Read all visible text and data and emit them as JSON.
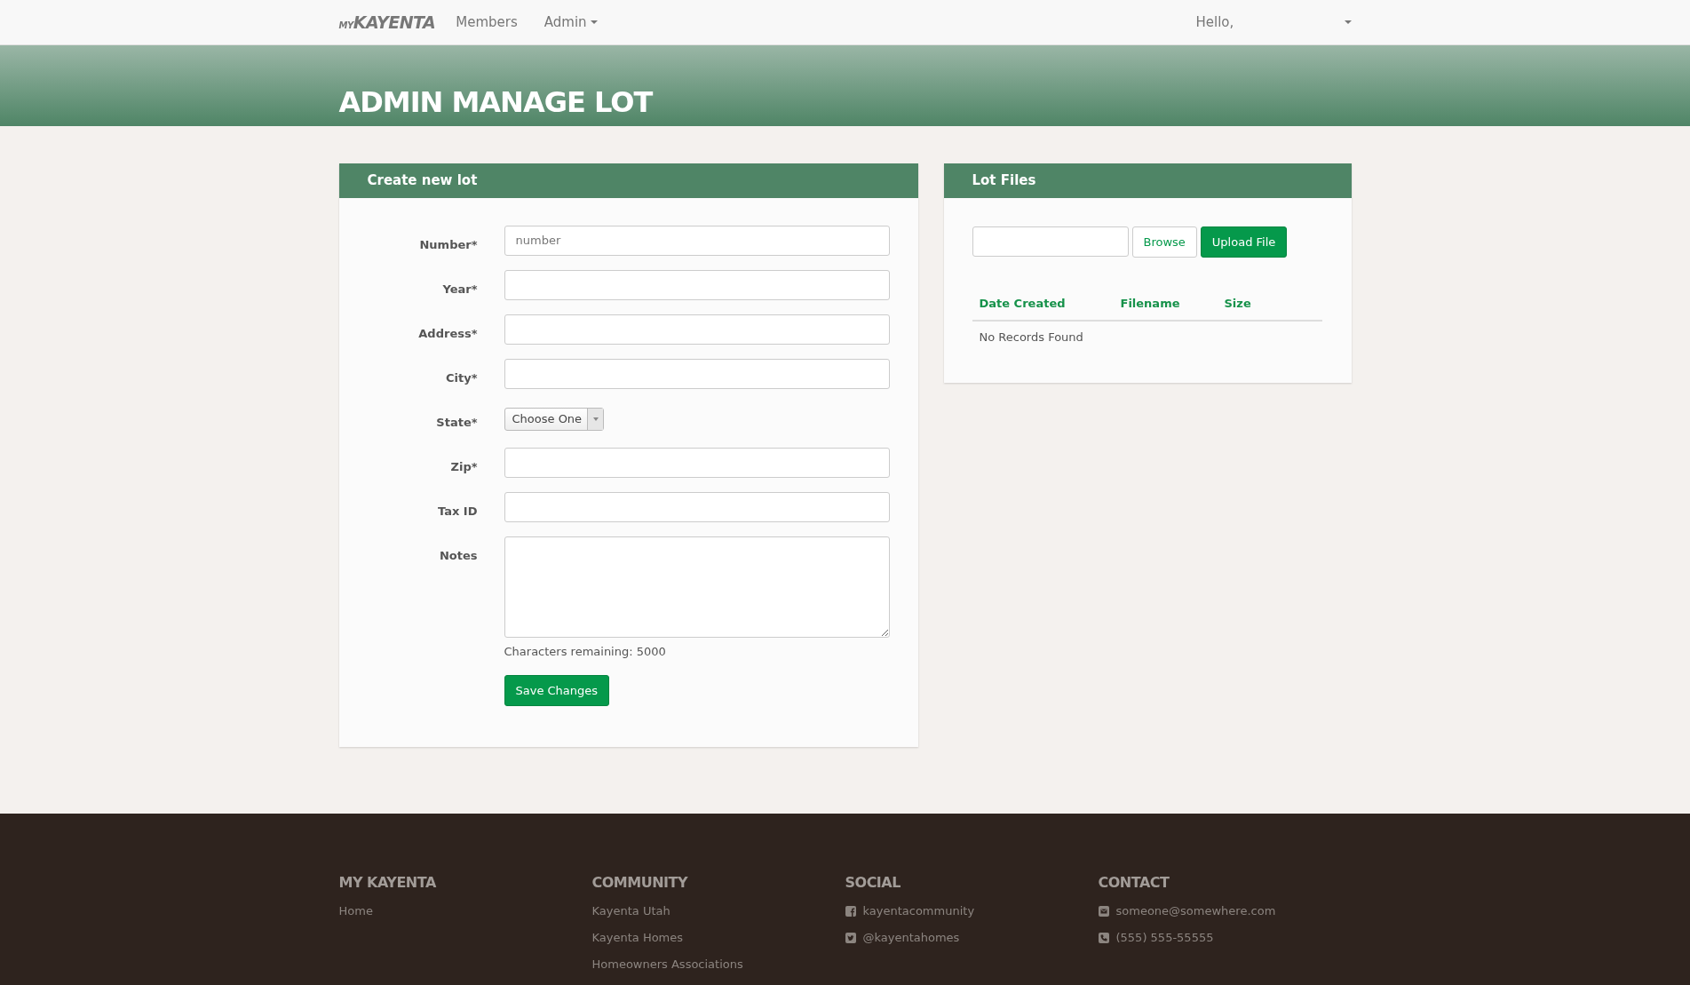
{
  "navbar": {
    "logo": {
      "small": "MY",
      "main": "KAYENTA"
    },
    "links": [
      {
        "label": "Members",
        "dropdown": false
      },
      {
        "label": "Admin",
        "dropdown": true
      }
    ],
    "user_menu": {
      "label": "Hello,"
    }
  },
  "page_title": "ADMIN MANAGE LOT",
  "create_form": {
    "title": "Create new lot",
    "fields": [
      {
        "kind": "text",
        "label": "Number*",
        "placeholder": "number"
      },
      {
        "kind": "text",
        "label": "Year*"
      },
      {
        "kind": "text",
        "label": "Address*"
      },
      {
        "kind": "text",
        "label": "City*"
      },
      {
        "kind": "select",
        "label": "State*",
        "value": "Choose One"
      },
      {
        "kind": "text",
        "label": "Zip*"
      },
      {
        "kind": "text",
        "label": "Tax ID"
      },
      {
        "kind": "textarea",
        "label": "Notes",
        "hint": "Characters remaining: 5000"
      }
    ],
    "submit": "Save Changes"
  },
  "lot_files": {
    "title": "Lot Files",
    "browse": "Browse",
    "upload": "Upload File",
    "table": {
      "columns": [
        "Date Created",
        "Filename",
        "Size"
      ],
      "empty": "No Records Found"
    }
  },
  "footer": {
    "columns": [
      {
        "heading": "MY KAYENTA",
        "items": [
          {
            "kind": "link",
            "text": "Home"
          }
        ]
      },
      {
        "heading": "COMMUNITY",
        "items": [
          {
            "kind": "link",
            "text": "Kayenta Utah"
          },
          {
            "kind": "link",
            "text": "Kayenta Homes"
          },
          {
            "kind": "link",
            "text": "Homeowners Associations"
          }
        ]
      },
      {
        "heading": "SOCIAL",
        "items": [
          {
            "kind": "facebook",
            "text": "kayentacommunity"
          },
          {
            "kind": "twitter",
            "text": "@kayentahomes"
          }
        ]
      },
      {
        "heading": "CONTACT",
        "items": [
          {
            "kind": "email",
            "text": "someone@somewhere.com"
          },
          {
            "kind": "phone",
            "text": "(555) 555-55555"
          }
        ]
      }
    ]
  }
}
